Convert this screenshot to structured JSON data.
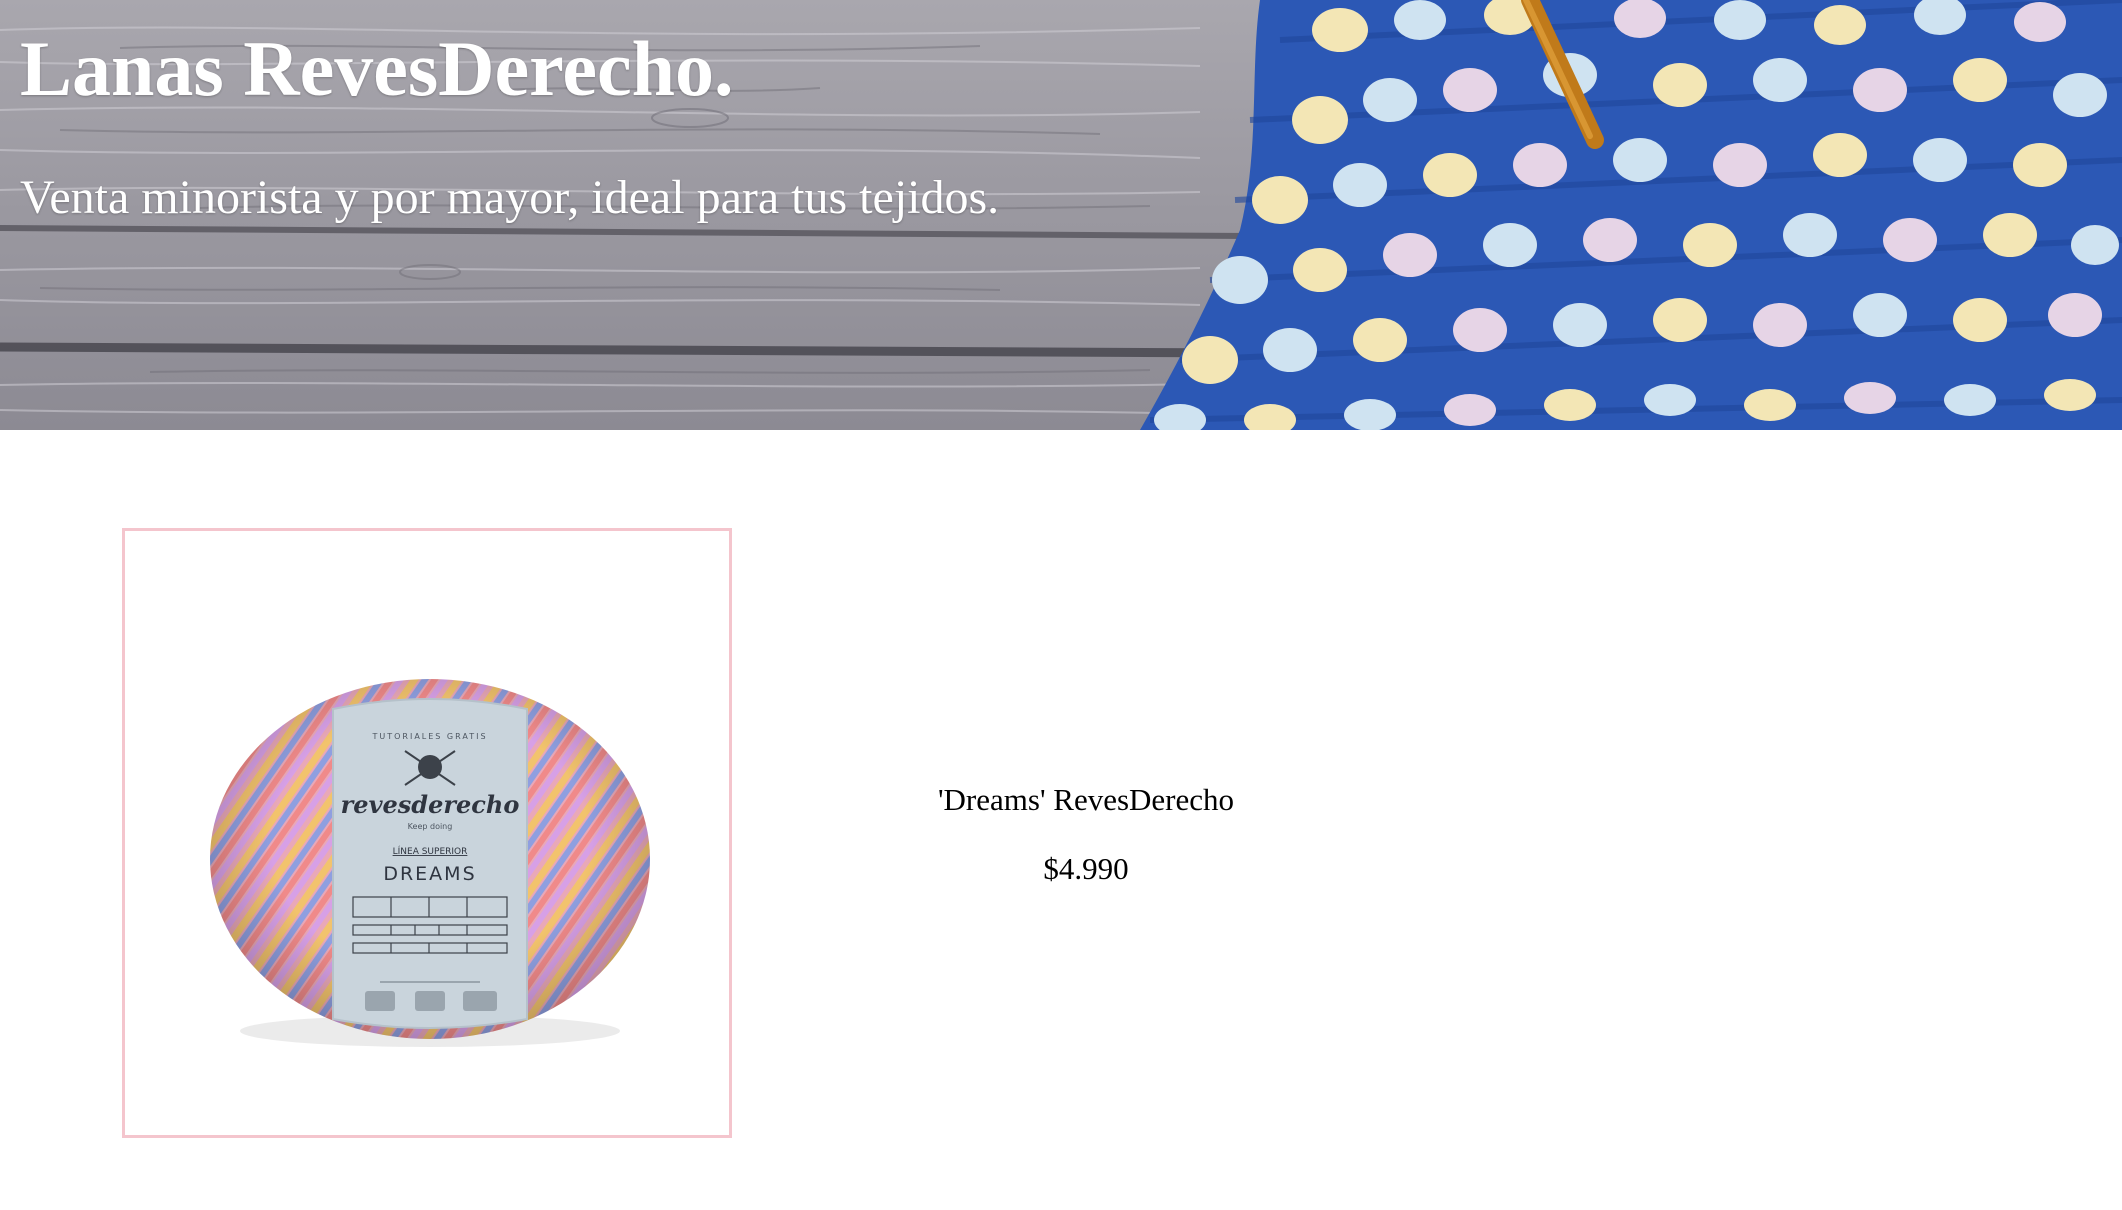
{
  "header": {
    "title": "Lanas RevesDerecho.",
    "subtitle": "Venta minorista y por mayor, ideal para tus tejidos."
  },
  "product": {
    "name": "'Dreams' RevesDerecho",
    "price": "$4.990",
    "image_alt": "revesderecho DREAMS yarn skein",
    "label": {
      "top": "TUTORIALES GRATIS",
      "brand": "revesderecho",
      "tagline": "Keep doing",
      "line": "LÍNEA SUPERIOR",
      "name": "DREAMS"
    }
  },
  "colors": {
    "title_text": "#ffffff",
    "card_border": "#f4c5cd",
    "background": "#ffffff",
    "wood": "#9c9aa1",
    "knit_blue": "#2f5fbf"
  }
}
